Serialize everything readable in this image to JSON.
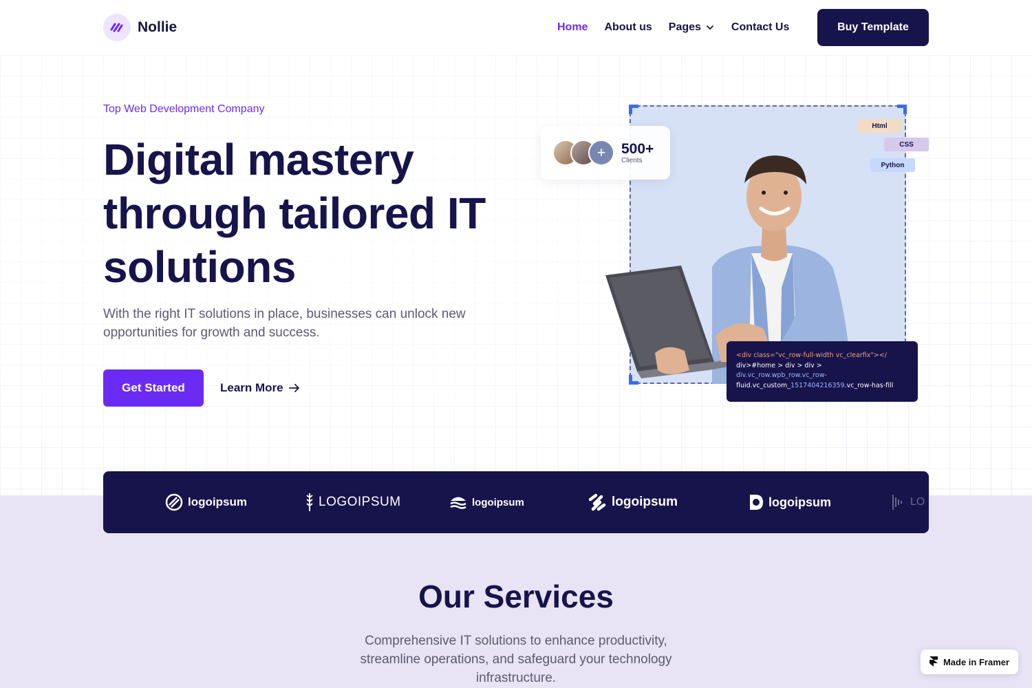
{
  "nav": {
    "brand": "Nollie",
    "items": [
      {
        "label": "Home",
        "active": true
      },
      {
        "label": "About us",
        "active": false
      },
      {
        "label": "Pages",
        "active": false,
        "has_dropdown": true
      },
      {
        "label": "Contact Us",
        "active": false
      }
    ],
    "cta": "Buy Template"
  },
  "hero": {
    "tagline": "Top Web Development Company",
    "headline": "Digital mastery through tailored IT solutions",
    "subtext": "With the right IT solutions in place, businesses can unlock new opportunities for growth and success.",
    "primary_button": "Get Started",
    "secondary_button": "Learn More",
    "clients": {
      "count": "500+",
      "label": "Clients"
    },
    "chips": [
      "Html",
      "CSS",
      "Python"
    ],
    "code": {
      "line1": "<div class=\"vc_row-full-width vc_clearfix\"></",
      "line2": "div>#home > div > div >",
      "line3": "div.vc_row.wpb_row.vc_row-",
      "line4a": "fluid.vc_custom_",
      "line4b": "1517404216359",
      "line4c": ".vc_row-has-fill"
    }
  },
  "logos": [
    "logoipsum",
    "LOGOIPSUM",
    "logoipsum",
    "logoipsum",
    "logoipsum",
    "LO"
  ],
  "services": {
    "title": "Our Services",
    "subtitle": "Comprehensive IT solutions to enhance productivity, streamline operations, and safeguard your technology infrastructure."
  },
  "framer_badge": "Made in Framer",
  "colors": {
    "accent": "#6a2cf5",
    "navy": "#17134b",
    "lavender": "#e8e4f5"
  }
}
